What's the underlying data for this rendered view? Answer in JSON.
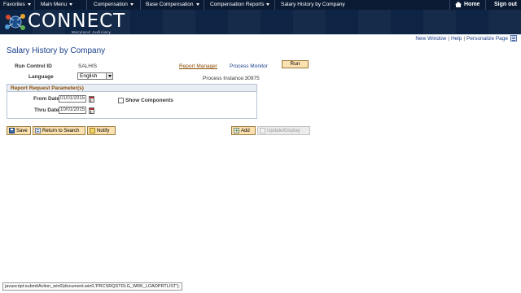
{
  "topnav": {
    "favorites": "Favorites",
    "main_menu": "Main Menu",
    "crumb1": "Compensation",
    "crumb2": "Base Compensation",
    "crumb3": "Compensation Reports",
    "crumb4": "Salary History by Company",
    "home": "Home",
    "signout": "Sign out"
  },
  "header": {
    "logo": "CONNECT",
    "subtitle": "Maryland Judiciary"
  },
  "util_links": {
    "new_window": "New Window",
    "help": "Help",
    "personalize": "Personalize Page",
    "separator": "|"
  },
  "page": {
    "title": "Salary History by Company",
    "run_control_label": "Run Control ID",
    "run_control_value": "SALHIS",
    "report_manager": "Report Manager",
    "process_monitor": "Process Monitor",
    "run_button": "Run",
    "language_label": "Language",
    "language_value": "English",
    "process_instance": "Process Instance:30975",
    "group_title": "Report Request Parameter(s)",
    "from_date_label": "From Date",
    "from_date_value": "01/01/2015",
    "show_components": "Show Components",
    "thru_date_label": "Thru Date",
    "thru_date_value": "10/01/2015"
  },
  "toolbar": {
    "save": "Save",
    "return_to_search": "Return to Search",
    "notify": "Notify",
    "add": "Add",
    "update_display": "Update/Display"
  },
  "statusbar": {
    "text": "javascript:submitAction_win0(document.win0,'PRCSRQSTDLG_WRK_LOADPRTLIST');"
  },
  "colors": {
    "nav_bg": "#0a1a33",
    "header_bg": "#0e2444",
    "link_blue": "#1b3f8b",
    "link_orange": "#8a4a00",
    "button_bg": "#fbe1b0"
  }
}
